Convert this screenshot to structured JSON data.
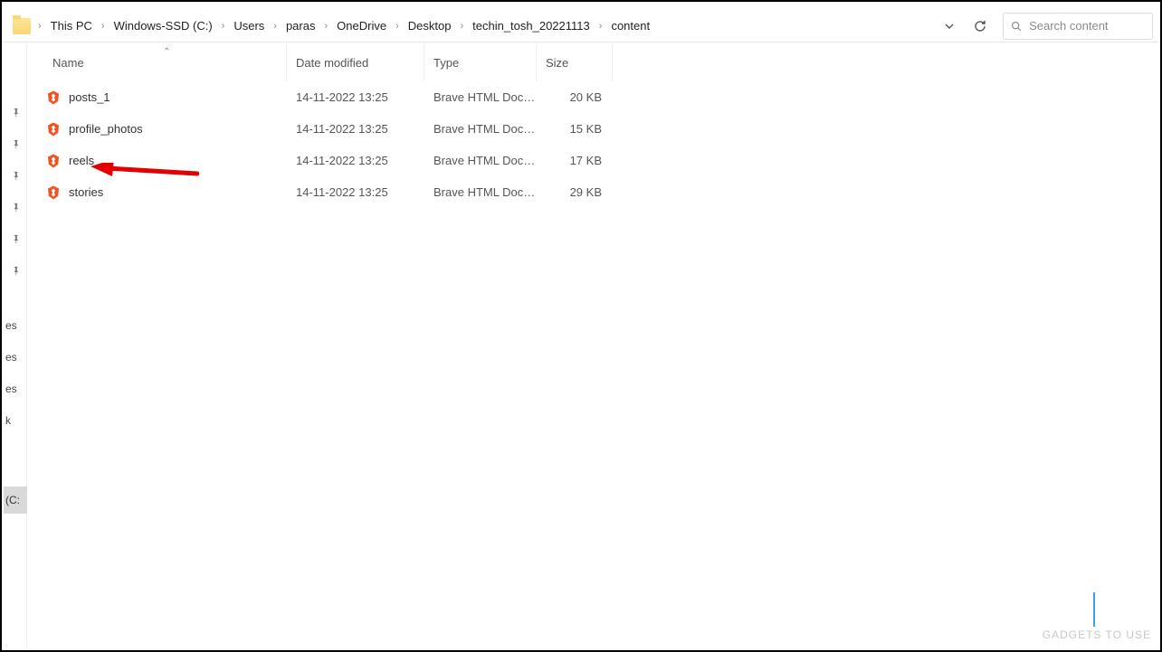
{
  "breadcrumbs": [
    "This PC",
    "Windows-SSD (C:)",
    "Users",
    "paras",
    "OneDrive",
    "Desktop",
    "techin_tosh_20221113",
    "content"
  ],
  "search": {
    "placeholder": "Search content"
  },
  "columns": {
    "name": "Name",
    "date": "Date modified",
    "type": "Type",
    "size": "Size"
  },
  "rows": [
    {
      "name": "posts_1",
      "date": "14-11-2022 13:25",
      "type": "Brave HTML Docu…",
      "size": "20 KB"
    },
    {
      "name": "profile_photos",
      "date": "14-11-2022 13:25",
      "type": "Brave HTML Docu…",
      "size": "15 KB"
    },
    {
      "name": "reels",
      "date": "14-11-2022 13:25",
      "type": "Brave HTML Docu…",
      "size": "17 KB"
    },
    {
      "name": "stories",
      "date": "14-11-2022 13:25",
      "type": "Brave HTML Docu…",
      "size": "29 KB"
    }
  ],
  "nav_tail": [
    "es",
    "es",
    "es",
    "k"
  ],
  "nav_selected": "(C:",
  "watermark": "GADGETS TO USE"
}
